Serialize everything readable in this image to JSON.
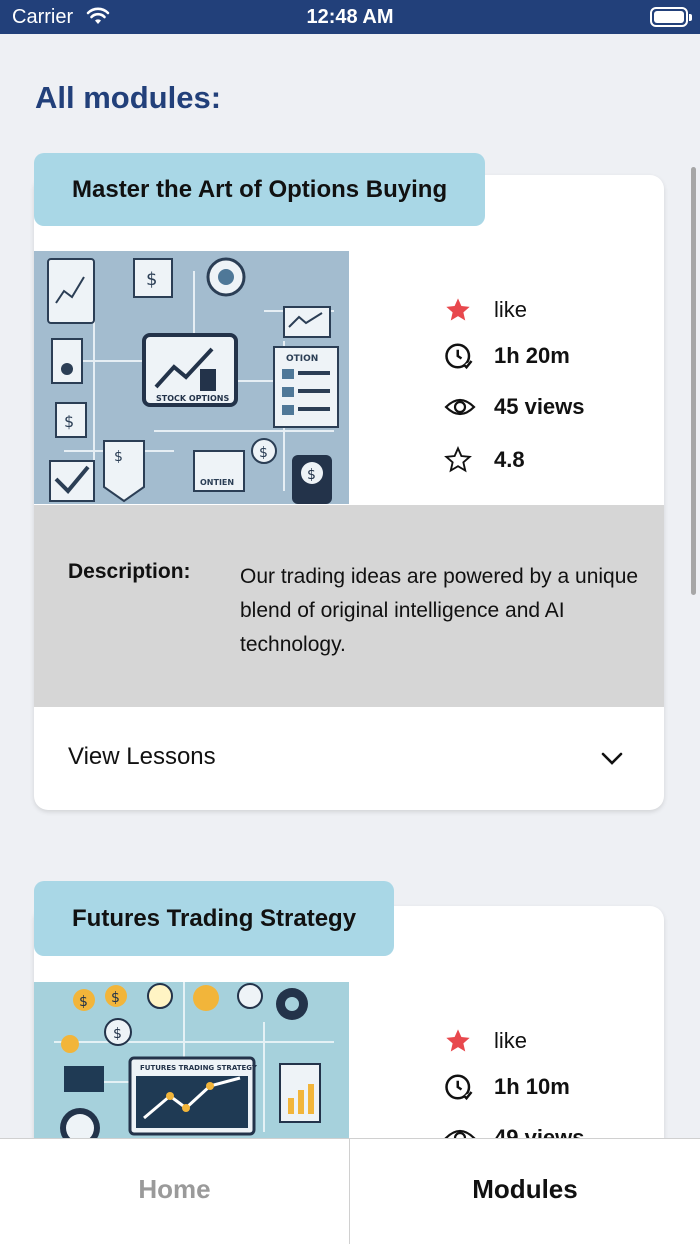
{
  "status_bar": {
    "carrier": "Carrier",
    "time": "12:48 AM"
  },
  "page_title": "All modules:",
  "modules": [
    {
      "title": "Master the Art of Options Buying",
      "image_caption": "STOCK OPTIONS",
      "image_extra_label_1": "OTION",
      "image_extra_label_2": "ONTIEN",
      "like_label": "like",
      "duration": "1h 20m",
      "views": "45 views",
      "rating": "4.8",
      "description_label": "Description:",
      "description": "Our trading ideas are powered by a unique blend of original intelligence and AI technology.",
      "view_lessons_label": "View Lessons"
    },
    {
      "title": "Futures Trading Strategy",
      "image_caption": "FUTURES TRADING STRATEGY",
      "like_label": "like",
      "duration": "1h 10m",
      "views": "49 views"
    }
  ],
  "tab_bar": {
    "home": "Home",
    "modules": "Modules",
    "active": "Modules"
  },
  "colors": {
    "header": "#22407a",
    "title_tab": "#a9d7e6",
    "like_star": "#e8484d",
    "description_bg": "#d6d6d6"
  }
}
